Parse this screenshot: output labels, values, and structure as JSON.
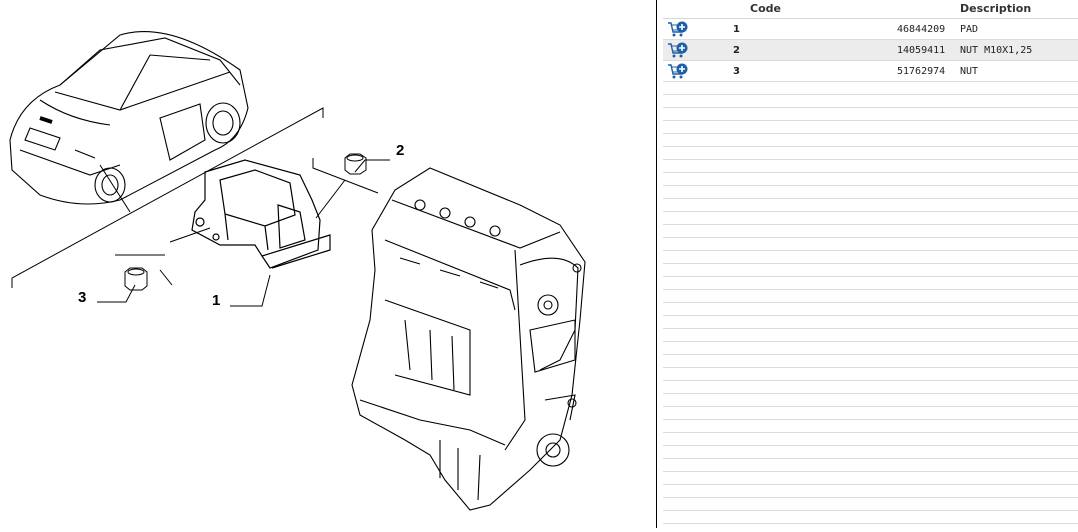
{
  "table": {
    "headers": {
      "code": "Code",
      "description": "Description"
    },
    "rows": [
      {
        "ref": "1",
        "code": "46844209",
        "description": "PAD"
      },
      {
        "ref": "2",
        "code": "14059411",
        "description": "NUT M10X1,25"
      },
      {
        "ref": "3",
        "code": "51762974",
        "description": "NUT"
      }
    ]
  },
  "diagram": {
    "callouts": [
      "1",
      "2",
      "3"
    ]
  },
  "colors": {
    "cart_icon": "#1f5fa8",
    "row_alt": "#ececec"
  },
  "icons": {
    "add_to_cart": "cart-add-icon"
  }
}
